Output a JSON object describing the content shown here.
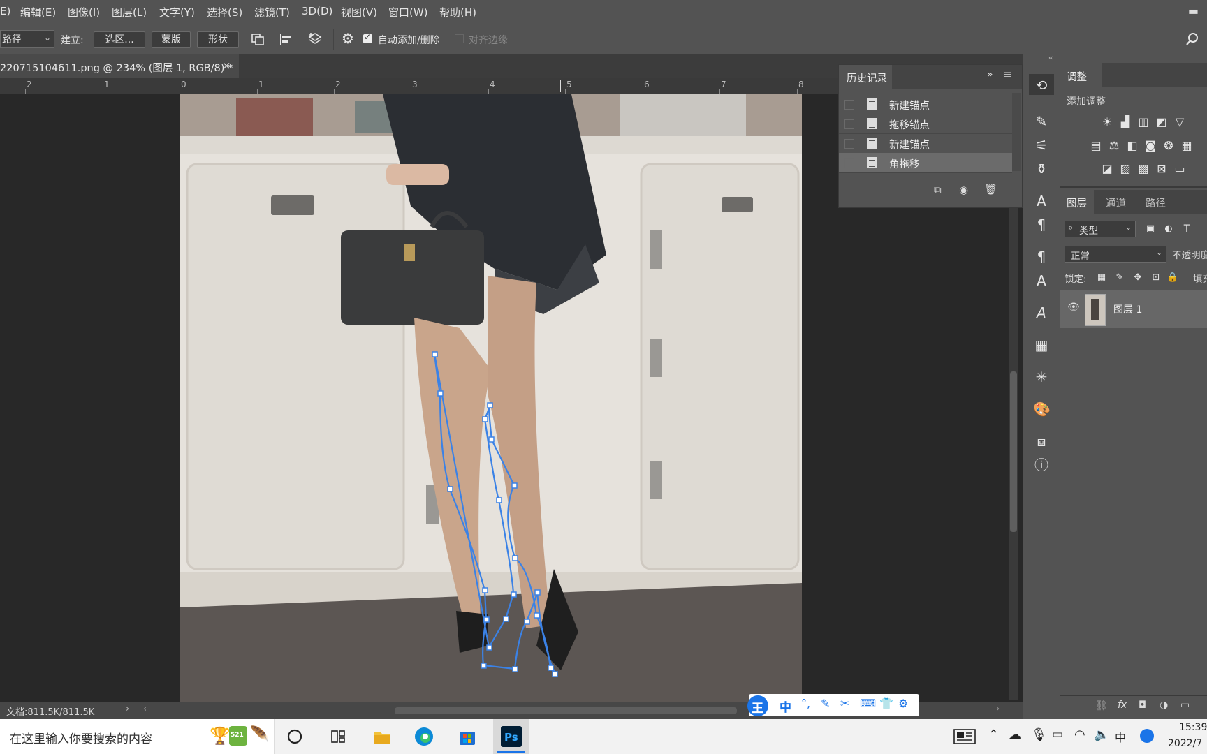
{
  "menu": {
    "items": [
      "E)",
      "编辑(E)",
      "图像(I)",
      "图层(L)",
      "文字(Y)",
      "选择(S)",
      "滤镜(T)",
      "3D(D)",
      "视图(V)",
      "窗口(W)",
      "帮助(H)"
    ]
  },
  "options": {
    "mode_value": "路径",
    "make_label": "建立:",
    "selection_btn": "选区...",
    "mask_btn": "蒙版",
    "shape_btn": "形状",
    "auto_add_label": "自动添加/删除",
    "auto_add_checked": true,
    "align_edges_label": "对齐边缘",
    "align_edges_checked": false
  },
  "document": {
    "tab_title": "220715104611.png @ 234% (图层 1, RGB/8) *",
    "close_glyph": "×"
  },
  "ruler": {
    "labels": [
      "2",
      "1",
      "0",
      "1",
      "2",
      "3",
      "4",
      "5",
      "6",
      "7",
      "8"
    ]
  },
  "history": {
    "tab": "历史记录",
    "items": [
      {
        "label": "新建锚点",
        "selected": false
      },
      {
        "label": "拖移锚点",
        "selected": false
      },
      {
        "label": "新建锚点",
        "selected": false
      },
      {
        "label": "角拖移",
        "selected": true
      }
    ]
  },
  "adjustments": {
    "tab": "调整",
    "add_label": "添加调整"
  },
  "layers": {
    "tabs": [
      "图层",
      "通道",
      "路径"
    ],
    "filter_label": "类型",
    "blend_mode": "正常",
    "opacity_label": "不透明度",
    "lock_label": "锁定:",
    "fill_label": "填充",
    "items": [
      {
        "name": "图层 1",
        "visible": true
      }
    ]
  },
  "status": {
    "doc_size": "文档:811.5K/811.5K"
  },
  "ime": {
    "logo": "王",
    "mode": "中"
  },
  "taskbar": {
    "search_placeholder": "在这里输入你要搜索的内容",
    "badge": "521",
    "clock_time": "15:39",
    "clock_date": "2022/7",
    "tray_ime": "中"
  },
  "colors": {
    "ps_bg": "#535353",
    "canvas_bg": "#282828",
    "path_stroke": "#3b82e6",
    "accent_blue": "#1a74e8"
  }
}
